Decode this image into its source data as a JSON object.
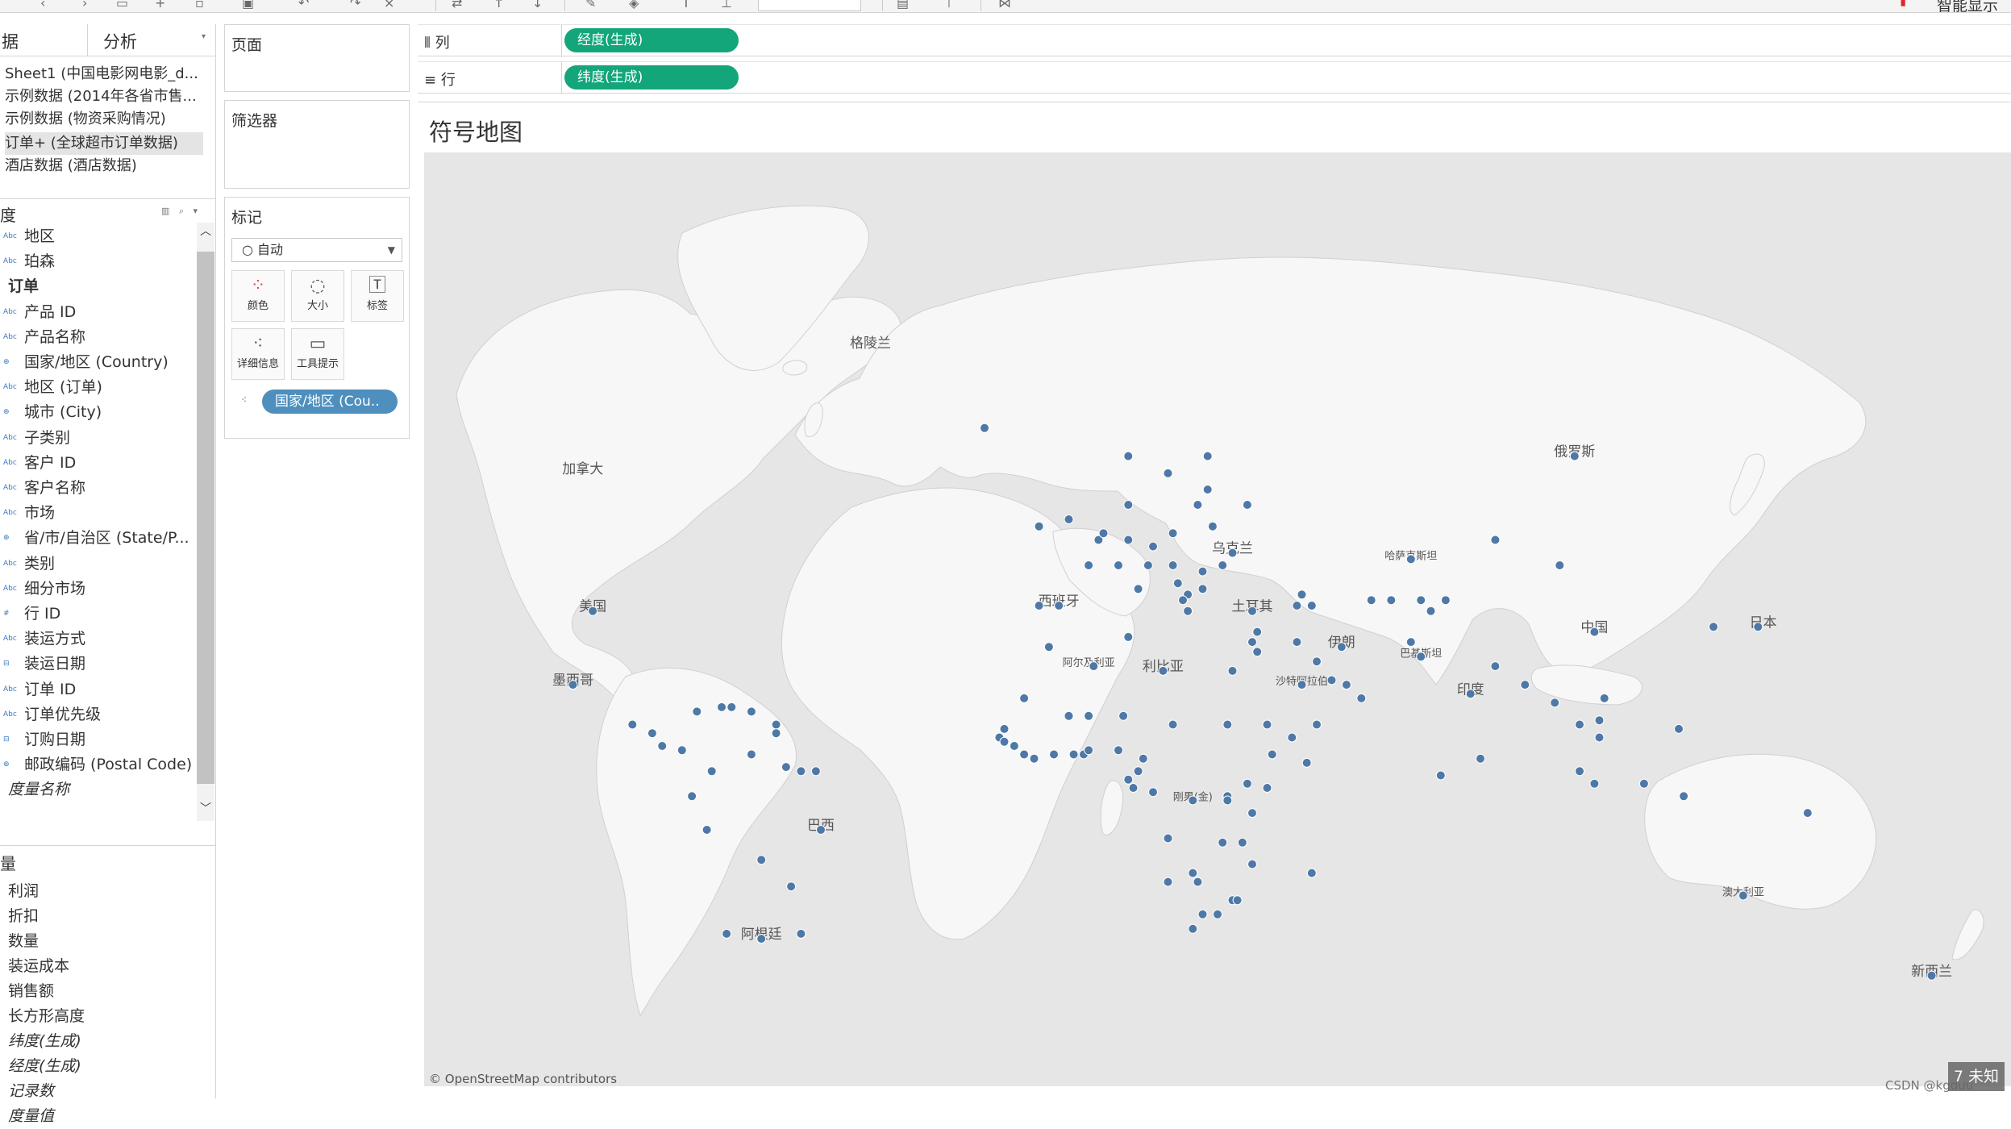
{
  "toolbar": {
    "show_me_label": "智能显示"
  },
  "left": {
    "tab_data": "据",
    "tab_analysis": "分析",
    "datasources": [
      "Sheet1 (中国电影网电影_d...",
      "示例数据 (2014年各省市售...",
      "示例数据 (物资采购情况)",
      "订单+ (全球超市订单数据)",
      "酒店数据 (酒店数据)"
    ],
    "selected_datasource": 3,
    "dimensions_header": "度",
    "dimensions": [
      {
        "type": "Abc",
        "name": "地区"
      },
      {
        "type": "Abc",
        "name": "珀森"
      },
      {
        "type": "group",
        "name": "订单"
      },
      {
        "type": "Abc",
        "name": "产品 ID"
      },
      {
        "type": "Abc",
        "name": "产品名称"
      },
      {
        "type": "globe",
        "name": "国家/地区 (Country)"
      },
      {
        "type": "Abc",
        "name": "地区 (订单)"
      },
      {
        "type": "globe",
        "name": "城市 (City)"
      },
      {
        "type": "Abc",
        "name": "子类别"
      },
      {
        "type": "Abc",
        "name": "客户 ID"
      },
      {
        "type": "Abc",
        "name": "客户名称"
      },
      {
        "type": "Abc",
        "name": "市场"
      },
      {
        "type": "globe",
        "name": "省/市/自治区 (State/P..."
      },
      {
        "type": "Abc",
        "name": "类别"
      },
      {
        "type": "Abc",
        "name": "细分市场"
      },
      {
        "type": "#",
        "name": "行 ID"
      },
      {
        "type": "Abc",
        "name": "装运方式"
      },
      {
        "type": "date",
        "name": "装运日期"
      },
      {
        "type": "Abc",
        "name": "订单 ID"
      },
      {
        "type": "Abc",
        "name": "订单优先级"
      },
      {
        "type": "date",
        "name": "订购日期"
      },
      {
        "type": "globe",
        "name": "邮政编码 (Postal Code)"
      },
      {
        "type": "italic",
        "name": "度量名称"
      }
    ],
    "measures_header": "量",
    "measures": [
      {
        "name": "利润",
        "italic": false
      },
      {
        "name": "折扣",
        "italic": false
      },
      {
        "name": "数量",
        "italic": false
      },
      {
        "name": "装运成本",
        "italic": false
      },
      {
        "name": "销售额",
        "italic": false
      },
      {
        "name": "长方形高度",
        "italic": false
      },
      {
        "name": "纬度(生成)",
        "italic": true
      },
      {
        "name": "经度(生成)",
        "italic": true
      },
      {
        "name": "记录数",
        "italic": true
      },
      {
        "name": "度量值",
        "italic": true
      }
    ]
  },
  "cards": {
    "pages_title": "页面",
    "filters_title": "筛选器",
    "marks_title": "标记",
    "mark_type": "○ 自动",
    "mark_buttons": [
      {
        "icon": "color-icon",
        "label": "颜色"
      },
      {
        "icon": "size-icon",
        "label": "大小"
      },
      {
        "icon": "label-icon",
        "label": "标签"
      },
      {
        "icon": "detail-icon",
        "label": "详细信息"
      },
      {
        "icon": "tooltip-icon",
        "label": "工具提示"
      }
    ],
    "detail_pill": "国家/地区 (Cou.."
  },
  "shelves": {
    "columns_label": "列",
    "columns_pill": "经度(生成)",
    "rows_label": "行",
    "rows_pill": "纬度(生成)"
  },
  "view": {
    "title": "符号地图",
    "attribution": "© OpenStreetMap contributors",
    "watermark": "CSDN @kgduu",
    "unknown_badge": "7 未知",
    "map_labels": [
      {
        "text": "格陵兰",
        "lon": -42,
        "lat": 72
      },
      {
        "text": "加拿大",
        "lon": -100,
        "lat": 60
      },
      {
        "text": "美国",
        "lon": -98,
        "lat": 39
      },
      {
        "text": "墨西哥",
        "lon": -102,
        "lat": 24
      },
      {
        "text": "巴西",
        "lon": -52,
        "lat": -10
      },
      {
        "text": "阿根廷",
        "lon": -64,
        "lat": -34
      },
      {
        "text": "俄罗斯",
        "lon": 100,
        "lat": 62
      },
      {
        "text": "哈萨克斯坦",
        "lon": 67,
        "lat": 48
      },
      {
        "text": "中国",
        "lon": 104,
        "lat": 35
      },
      {
        "text": "印度",
        "lon": 79,
        "lat": 22
      },
      {
        "text": "巴基斯坦",
        "lon": 69,
        "lat": 30
      },
      {
        "text": "阿尔及利亚",
        "lon": 2,
        "lat": 28
      },
      {
        "text": "利比亚",
        "lon": 17,
        "lat": 27
      },
      {
        "text": "沙特阿拉伯",
        "lon": 45,
        "lat": 24
      },
      {
        "text": "刚果(金)",
        "lon": 23,
        "lat": -3
      },
      {
        "text": "澳大利亚",
        "lon": 134,
        "lat": -25
      },
      {
        "text": "新西兰",
        "lon": 172,
        "lat": -41
      },
      {
        "text": "土耳其",
        "lon": 35,
        "lat": 39
      },
      {
        "text": "伊朗",
        "lon": 53,
        "lat": 32
      },
      {
        "text": "乌克兰",
        "lon": 31,
        "lat": 49
      },
      {
        "text": "西班牙",
        "lon": -4,
        "lat": 40
      },
      {
        "text": "日本",
        "lon": 138,
        "lat": 36
      }
    ],
    "points": [
      [
        -98,
        39
      ],
      [
        -102,
        24
      ],
      [
        -90,
        15
      ],
      [
        -86,
        13
      ],
      [
        -84,
        10
      ],
      [
        -80,
        9
      ],
      [
        -77,
        18
      ],
      [
        -72,
        19
      ],
      [
        -66,
        18
      ],
      [
        -70,
        19
      ],
      [
        -61,
        15
      ],
      [
        -61,
        13
      ],
      [
        -74,
        4
      ],
      [
        -66,
        8
      ],
      [
        -59,
        5
      ],
      [
        -56,
        4
      ],
      [
        -53,
        4
      ],
      [
        -78,
        -2
      ],
      [
        -75,
        -10
      ],
      [
        -64,
        -17
      ],
      [
        -58,
        -23
      ],
      [
        -71,
        -33
      ],
      [
        -56,
        -33
      ],
      [
        -64,
        -34
      ],
      [
        -52,
        -10
      ],
      [
        -8,
        53
      ],
      [
        -2,
        54
      ],
      [
        2,
        47
      ],
      [
        -4,
        40
      ],
      [
        -8,
        40
      ],
      [
        4,
        51
      ],
      [
        5,
        52
      ],
      [
        10,
        51
      ],
      [
        8,
        47
      ],
      [
        12,
        43
      ],
      [
        14,
        47
      ],
      [
        15,
        50
      ],
      [
        19,
        52
      ],
      [
        19,
        47
      ],
      [
        20,
        44
      ],
      [
        22,
        42
      ],
      [
        25,
        46
      ],
      [
        21,
        41
      ],
      [
        22,
        39
      ],
      [
        25,
        43
      ],
      [
        26,
        58
      ],
      [
        24,
        56
      ],
      [
        27,
        53
      ],
      [
        31,
        49
      ],
      [
        29,
        47
      ],
      [
        10,
        56
      ],
      [
        10,
        62
      ],
      [
        18,
        60
      ],
      [
        26,
        62
      ],
      [
        -19,
        65
      ],
      [
        34,
        56
      ],
      [
        44,
        40
      ],
      [
        45,
        42
      ],
      [
        47,
        40
      ],
      [
        35,
        39
      ],
      [
        36,
        35
      ],
      [
        35,
        33
      ],
      [
        36,
        31
      ],
      [
        31,
        27
      ],
      [
        44,
        33
      ],
      [
        53,
        32
      ],
      [
        45,
        24
      ],
      [
        48,
        29
      ],
      [
        51,
        25
      ],
      [
        54,
        24
      ],
      [
        57,
        21
      ],
      [
        48,
        15
      ],
      [
        59,
        41
      ],
      [
        63,
        41
      ],
      [
        69,
        41
      ],
      [
        71,
        39
      ],
      [
        67,
        33
      ],
      [
        69,
        30
      ],
      [
        67,
        48
      ],
      [
        74,
        41
      ],
      [
        84,
        51
      ],
      [
        97,
        47
      ],
      [
        104,
        35
      ],
      [
        79,
        22
      ],
      [
        84,
        28
      ],
      [
        90,
        24
      ],
      [
        96,
        20
      ],
      [
        101,
        15
      ],
      [
        105,
        16
      ],
      [
        106,
        21
      ],
      [
        105,
        12
      ],
      [
        81,
        7
      ],
      [
        73,
        3
      ],
      [
        101,
        4
      ],
      [
        104,
        1
      ],
      [
        114,
        1
      ],
      [
        121,
        14
      ],
      [
        122,
        -2
      ],
      [
        137,
        36
      ],
      [
        128,
        36
      ],
      [
        100,
        62
      ],
      [
        147,
        -6
      ],
      [
        134,
        -25
      ],
      [
        172,
        -41
      ],
      [
        10,
        34
      ],
      [
        3,
        28
      ],
      [
        17,
        27
      ],
      [
        -6,
        32
      ],
      [
        -11,
        21
      ],
      [
        -2,
        17
      ],
      [
        2,
        17
      ],
      [
        9,
        17
      ],
      [
        19,
        15
      ],
      [
        30,
        15
      ],
      [
        39,
        8
      ],
      [
        46,
        6
      ],
      [
        38,
        15
      ],
      [
        43,
        12
      ],
      [
        -15,
        14
      ],
      [
        -16,
        12
      ],
      [
        -15,
        11
      ],
      [
        -13,
        10
      ],
      [
        -11,
        8
      ],
      [
        -9,
        7
      ],
      [
        -5,
        8
      ],
      [
        -1,
        8
      ],
      [
        1,
        8
      ],
      [
        2,
        9
      ],
      [
        8,
        9
      ],
      [
        13,
        7
      ],
      [
        12,
        4
      ],
      [
        15,
        -1
      ],
      [
        23,
        -3
      ],
      [
        11,
        0
      ],
      [
        10,
        2
      ],
      [
        30,
        -2
      ],
      [
        30,
        -3
      ],
      [
        34,
        1
      ],
      [
        38,
        0
      ],
      [
        35,
        -6
      ],
      [
        29,
        -13
      ],
      [
        33,
        -13
      ],
      [
        35,
        -18
      ],
      [
        47,
        -20
      ],
      [
        18,
        -12
      ],
      [
        18,
        -22
      ],
      [
        24,
        -22
      ],
      [
        31,
        -26
      ],
      [
        28,
        -29
      ],
      [
        25,
        -29
      ],
      [
        32,
        -26
      ],
      [
        23,
        -32
      ],
      [
        23,
        -20
      ]
    ]
  }
}
